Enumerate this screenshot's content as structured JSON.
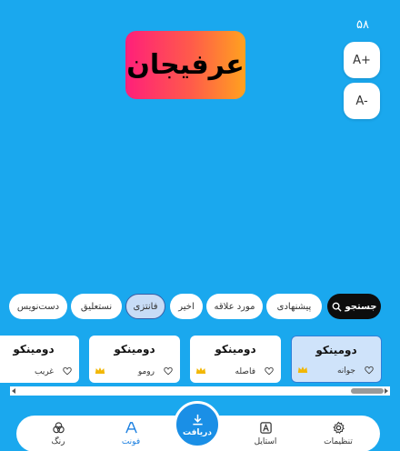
{
  "counter": "۵۸",
  "size_controls": {
    "increase": "A+",
    "decrease": "A-"
  },
  "art_text": "عرفیجان",
  "art_gradient": [
    "#ff1f7a",
    "#ffa21f"
  ],
  "chips": [
    {
      "label": "جستجو",
      "icon": "search-icon",
      "type": "search"
    },
    {
      "label": "پیشنهادی"
    },
    {
      "label": "مورد علاقه"
    },
    {
      "label": "اخیر"
    },
    {
      "label": "فانتزی",
      "active": true
    },
    {
      "label": "نستعلیق"
    },
    {
      "label": "دست‌نویس"
    }
  ],
  "fonts": [
    {
      "preview": "دومینکو",
      "name": "جوانه",
      "premium": true,
      "selected": true
    },
    {
      "preview": "دومینکو",
      "name": "فاصله",
      "premium": true
    },
    {
      "preview": "دومینکو",
      "name": "رومو",
      "premium": true
    },
    {
      "preview": "دومینکو",
      "name": "غریب",
      "premium": false
    }
  ],
  "nav": {
    "settings": "تنظیمات",
    "style": "استایل",
    "download": "دریافت",
    "font": "فونت",
    "color": "رنگ"
  },
  "colors": {
    "background": "#1aa8ee",
    "accent": "#1a7fe0",
    "premium": "#f2b705"
  }
}
